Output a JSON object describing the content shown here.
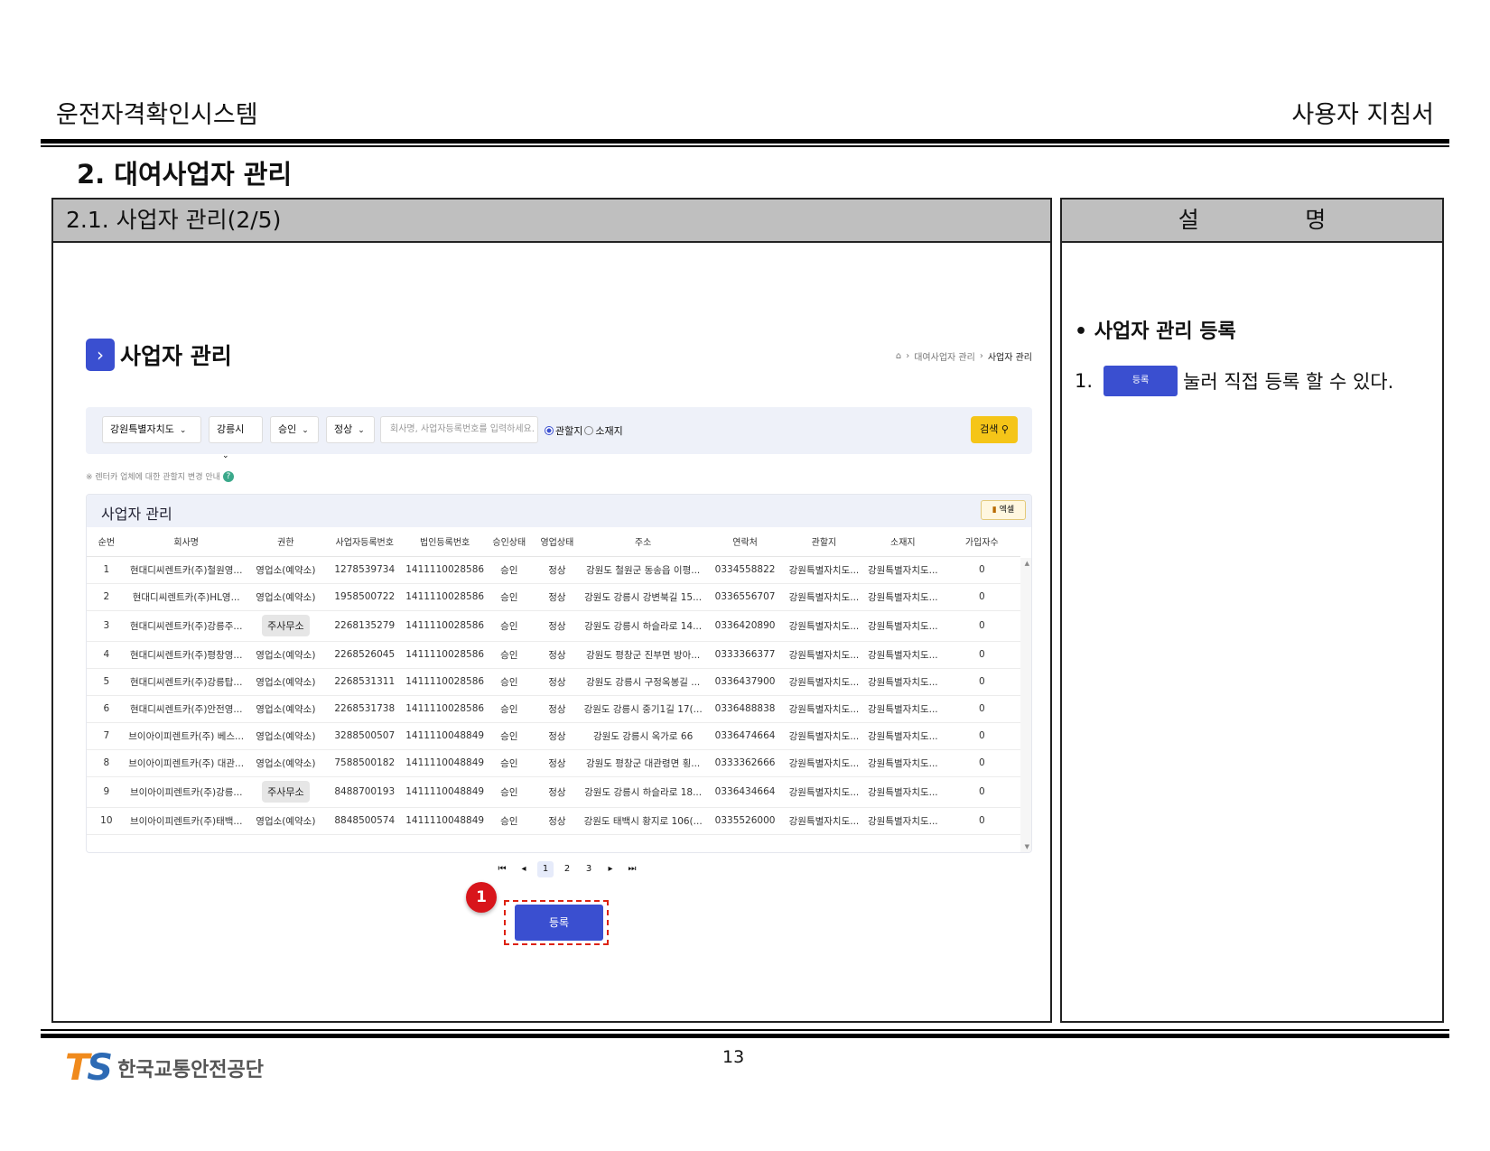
{
  "header": {
    "system_name": "운전자격확인시스템",
    "doc_type": "사용자 지침서"
  },
  "section_title": "2. 대여사업자 관리",
  "panel_left": {
    "title": "2.1. 사업자 관리(2/5)"
  },
  "panel_right": {
    "title_left": "설",
    "title_right": "명",
    "heading": "• 사업자 관리 등록",
    "step_index": "1.",
    "step_button_label": "등록",
    "step_text": "눌러 직접 등록 할 수 있다."
  },
  "screen": {
    "page_title": "사업자 관리",
    "title_icon": "chevron-right-icon",
    "breadcrumb": {
      "home_icon": "home-icon",
      "level1": "대여사업자 관리",
      "level2": "사업자 관리"
    },
    "filters": {
      "region": "강원특별자치도",
      "city": "강릉시",
      "approval": "승인",
      "status": "정상",
      "search_placeholder": "회사명, 사업자등록번호를 입력하세요.",
      "radio1": "관할지",
      "radio2": "소재지",
      "search_button": "검색"
    },
    "notice": "※ 렌터카 업체에 대한 관할지 변경 안내",
    "help_icon": "?",
    "grid": {
      "title": "사업자 관리",
      "excel_button": "엑셀",
      "columns": [
        "순번",
        "회사명",
        "권한",
        "사업자등록번호",
        "법인등록번호",
        "승인상태",
        "영업상태",
        "주소",
        "연락처",
        "관할지",
        "소재지",
        "가입자수"
      ],
      "rows": [
        [
          "1",
          "현대디씨렌트카(주)철원영...",
          "영업소(예약소)",
          "1278539734",
          "1411110028586",
          "승인",
          "정상",
          "강원도 철원군 동송읍 이평...",
          "0334558822",
          "강원특별자치도...",
          "강원특별자치도...",
          "0"
        ],
        [
          "2",
          "현대디씨렌트카(주)HL영...",
          "영업소(예약소)",
          "1958500722",
          "1411110028586",
          "승인",
          "정상",
          "강원도 강릉시 강변북길 15...",
          "0336556707",
          "강원특별자치도...",
          "강원특별자치도...",
          "0"
        ],
        [
          "3",
          "현대디씨렌트카(주)강릉주...",
          "주사무소",
          "2268135279",
          "1411110028586",
          "승인",
          "정상",
          "강원도 강릉시 하슬라로 14...",
          "0336420890",
          "강원특별자치도...",
          "강원특별자치도...",
          "0"
        ],
        [
          "4",
          "현대디씨렌트카(주)평창영...",
          "영업소(예약소)",
          "2268526045",
          "1411110028586",
          "승인",
          "정상",
          "강원도 평창군 진부면 방아...",
          "0333366377",
          "강원특별자치도...",
          "강원특별자치도...",
          "0"
        ],
        [
          "5",
          "현대디씨렌트카(주)강릉탑...",
          "영업소(예약소)",
          "2268531311",
          "1411110028586",
          "승인",
          "정상",
          "강원도 강릉시 구정옥봉길 ...",
          "0336437900",
          "강원특별자치도...",
          "강원특별자치도...",
          "0"
        ],
        [
          "6",
          "현대디씨렌트카(주)안전영...",
          "영업소(예약소)",
          "2268531738",
          "1411110028586",
          "승인",
          "정상",
          "강원도 강릉시 중기1길 17(...",
          "0336488838",
          "강원특별자치도...",
          "강원특별자치도...",
          "0"
        ],
        [
          "7",
          "브이아이피렌트카(주) 베스...",
          "영업소(예약소)",
          "3288500507",
          "1411110048849",
          "승인",
          "정상",
          "강원도 강릉시 옥가로 66",
          "0336474664",
          "강원특별자치도...",
          "강원특별자치도...",
          "0"
        ],
        [
          "8",
          "브이아이피렌트카(주) 대관...",
          "영업소(예약소)",
          "7588500182",
          "1411110048849",
          "승인",
          "정상",
          "강원도 평창군 대관령면 횡...",
          "0333362666",
          "강원특별자치도...",
          "강원특별자치도...",
          "0"
        ],
        [
          "9",
          "브이아이피렌트카(주)강릉...",
          "주사무소",
          "8488700193",
          "1411110048849",
          "승인",
          "정상",
          "강원도 강릉시 하슬라로 18...",
          "0336434664",
          "강원특별자치도...",
          "강원특별자치도...",
          "0"
        ],
        [
          "10",
          "브이아이피렌트카(주)태백...",
          "영업소(예약소)",
          "8848500574",
          "1411110048849",
          "승인",
          "정상",
          "강원도 태백시 황지로 106(...",
          "0335526000",
          "강원특별자치도...",
          "강원특별자치도...",
          "0"
        ]
      ]
    },
    "pagination": {
      "first": "⏮",
      "prev": "◂",
      "pages": [
        "1",
        "2",
        "3"
      ],
      "next": "▸",
      "last": "⏭",
      "current": "1"
    },
    "register_button": "등록",
    "callout_number": "1"
  },
  "footer": {
    "logo_t": "T",
    "logo_s": "S",
    "org_name": "한국교통안전공단",
    "page_number": "13"
  },
  "colors": {
    "primary": "#3a4fd0",
    "search": "#f5c518",
    "callout": "#d8151b",
    "panel_header": "#bfbfbf"
  }
}
